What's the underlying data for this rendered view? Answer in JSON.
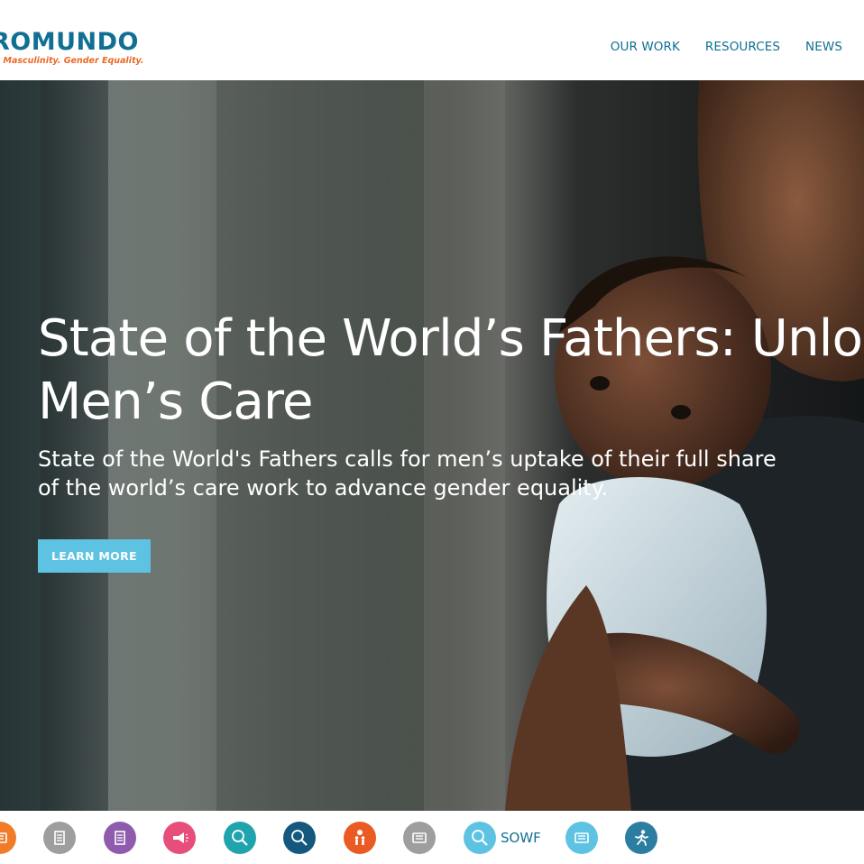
{
  "header": {
    "logo": {
      "wordmark": "ROMUNDO",
      "tagline": "y Masculinity. Gender Equality."
    },
    "nav": [
      {
        "label": "OUR WORK"
      },
      {
        "label": "RESOURCES"
      },
      {
        "label": "NEWS"
      }
    ]
  },
  "hero": {
    "title_line1": "State of the World’s Fathers: Unlocking",
    "title_line2": "Men’s Care",
    "subtitle": "State of the World's Fathers calls for men’s uptake of their full share of the world’s care work to advance gender equality.",
    "button_label": "LEARN MORE"
  },
  "iconbar": {
    "items": [
      {
        "icon": "newspaper-icon",
        "color": "#f07c2a"
      },
      {
        "icon": "document-icon",
        "color": "#9e9e9e"
      },
      {
        "icon": "document-icon",
        "color": "#8e5bae"
      },
      {
        "icon": "megaphone-icon",
        "color": "#e74f7a"
      },
      {
        "icon": "search-icon",
        "color": "#1fa3ad"
      },
      {
        "icon": "search-icon",
        "color": "#14587d"
      },
      {
        "icon": "family-icon",
        "color": "#ea5a23"
      },
      {
        "icon": "newspaper-icon",
        "color": "#9e9e9e"
      },
      {
        "icon": "search-icon",
        "color": "#5ec3e2",
        "label": "SOWF"
      },
      {
        "icon": "newspaper-icon",
        "color": "#5ec3e2"
      },
      {
        "icon": "running-person-icon",
        "color": "#2b7ea1"
      }
    ]
  }
}
